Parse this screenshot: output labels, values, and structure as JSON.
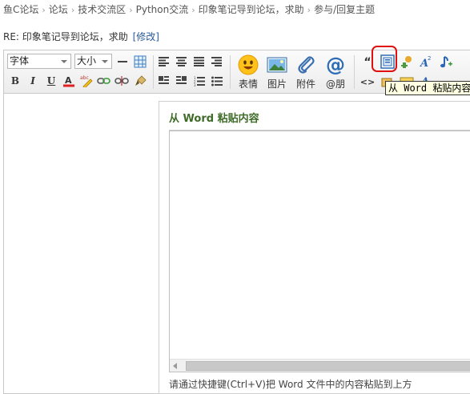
{
  "breadcrumb": {
    "items": [
      "鱼C论坛",
      "论坛",
      "技术交流区",
      "Python交流",
      "印象笔记导到论坛，求助",
      "参与/回复主题"
    ],
    "separator": "›"
  },
  "reply": {
    "title": "RE: 印象笔记导到论坛，求助",
    "edit_link": "[修改]"
  },
  "toolbar": {
    "font_select": "字体",
    "size_select": "大小",
    "quote_symbol": "“",
    "code_symbol": "<>",
    "groups": [
      {
        "label": "表情",
        "icon": "smiley-icon"
      },
      {
        "label": "图片",
        "icon": "image-icon"
      },
      {
        "label": "附件",
        "icon": "paperclip-icon"
      },
      {
        "label": "@朋",
        "icon": "at-icon"
      }
    ],
    "tooltip": "从 Word 粘贴内容"
  },
  "dialog": {
    "title": "从 Word 粘贴内容",
    "hint": "请通过快捷键(Ctrl+V)把 Word 文件中的内容粘贴到上方"
  },
  "colors": {
    "dialog_title": "#3f6b28",
    "highlight": "#e01010",
    "tooltip_bg": "#ffffe1"
  }
}
